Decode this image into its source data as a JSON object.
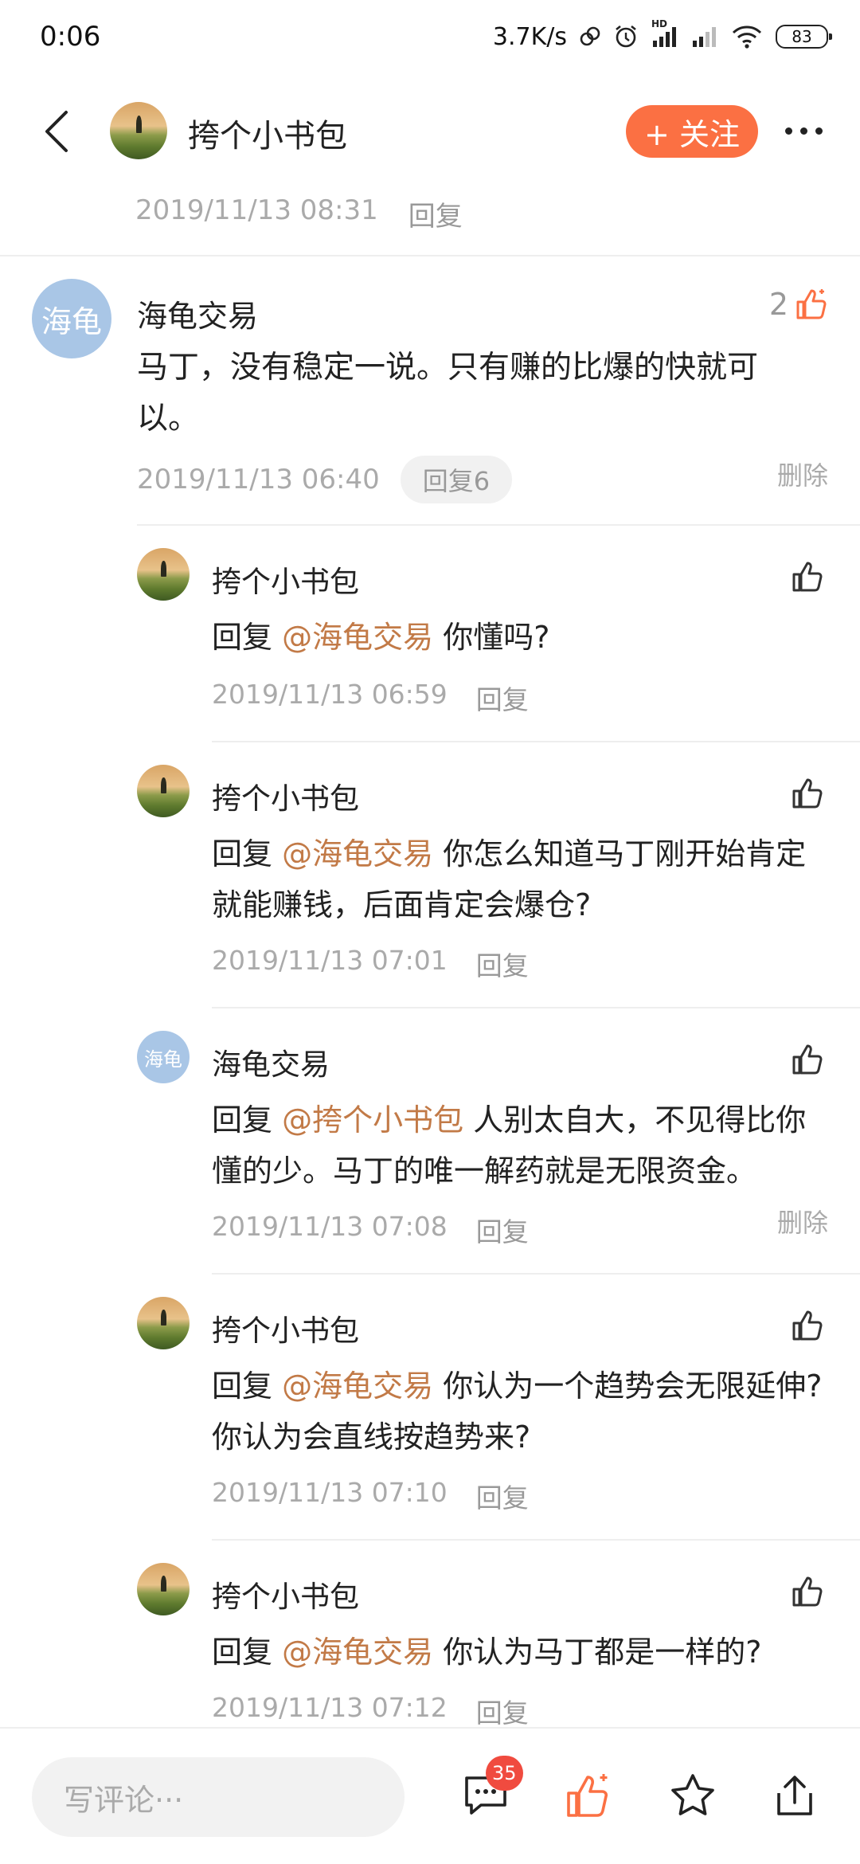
{
  "status_bar": {
    "time": "0:06",
    "net_speed": "3.7K/s",
    "hd_label": "HD",
    "battery": "83"
  },
  "header": {
    "username": "挎个小书包",
    "follow_label": "+ 关注"
  },
  "top_meta": {
    "date": "2019/11/13 08:31",
    "reply_label": "回复"
  },
  "main_comment": {
    "avatar_text": "海龟",
    "name": "海龟交易",
    "like_count": "2",
    "text": "马丁，没有稳定一说。只有赚的比爆的快就可以。",
    "date": "2019/11/13 06:40",
    "reply_pill": "回复6",
    "delete_label": "删除"
  },
  "replies": [
    {
      "name": "挎个小书包",
      "prefix": "回复 ",
      "mention": "@海龟交易",
      "text": " 你懂吗?",
      "date": "2019/11/13 06:59",
      "reply_label": "回复"
    },
    {
      "name": "挎个小书包",
      "prefix": "回复 ",
      "mention": "@海龟交易",
      "text": " 你怎么知道马丁刚开始肯定就能赚钱，后面肯定会爆仓?",
      "date": "2019/11/13 07:01",
      "reply_label": "回复"
    },
    {
      "name": "海龟交易",
      "avatar_text": "海龟",
      "prefix": "回复 ",
      "mention": "@挎个小书包",
      "text": " 人别太自大，不见得比你懂的少。马丁的唯一解药就是无限资金。",
      "date": "2019/11/13 07:08",
      "reply_label": "回复",
      "delete_label": "删除"
    },
    {
      "name": "挎个小书包",
      "prefix": "回复 ",
      "mention": "@海龟交易",
      "text": " 你认为一个趋势会无限延伸? 你认为会直线按趋势来?",
      "date": "2019/11/13 07:10",
      "reply_label": "回复"
    },
    {
      "name": "挎个小书包",
      "prefix": "回复 ",
      "mention": "@海龟交易",
      "text": " 你认为马丁都是一样的?",
      "date": "2019/11/13 07:12",
      "reply_label": "回复"
    }
  ],
  "bottom_bar": {
    "input_placeholder": "写评论···",
    "comment_badge": "35"
  },
  "colors": {
    "accent": "#fb7043",
    "mention": "#c27a47",
    "muted": "#aaaaaa",
    "badge": "#f04b3f"
  }
}
